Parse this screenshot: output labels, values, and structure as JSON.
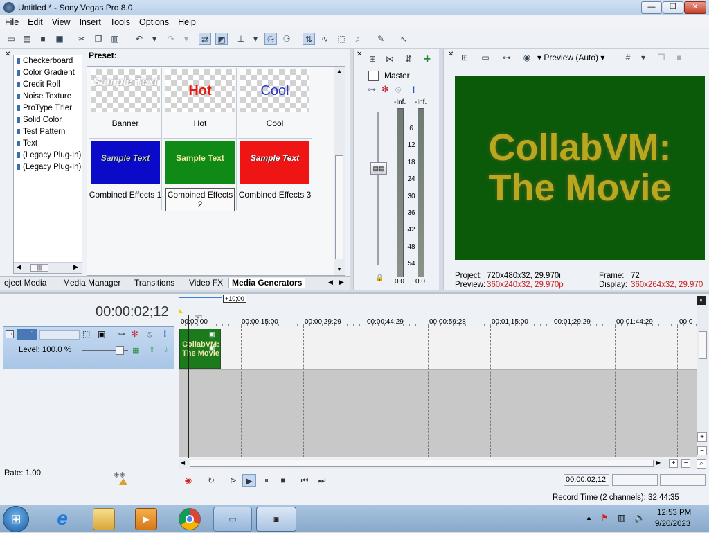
{
  "window": {
    "title": "Untitled * - Sony Vegas Pro 8.0",
    "min": "—",
    "restore": "❐",
    "close": "✕"
  },
  "menu": [
    "File",
    "Edit",
    "View",
    "Insert",
    "Tools",
    "Options",
    "Help"
  ],
  "generators": {
    "items": [
      "Checkerboard",
      "Color Gradient",
      "Credit Roll",
      "Noise Texture",
      "ProType Titler",
      "Solid Color",
      "Test Pattern",
      "Text",
      "(Legacy Plug-In) T",
      "(Legacy Plug-In) V"
    ],
    "preset_label": "Preset:",
    "presets": [
      {
        "name": "Banner",
        "thumb_text": "Sample Text"
      },
      {
        "name": "Hot",
        "thumb_text": "Hot"
      },
      {
        "name": "Cool",
        "thumb_text": "Cool"
      },
      {
        "name": "Combined Effects 1",
        "thumb_text": "Sample Text"
      },
      {
        "name": "Combined Effects 2",
        "thumb_text": "Sample Text"
      },
      {
        "name": "Combined Effects 3",
        "thumb_text": "Sample Text"
      }
    ],
    "tabs": [
      "oject Media",
      "Media Manager",
      "Transitions",
      "Video FX",
      "Media Generators"
    ]
  },
  "mixer": {
    "master_label": "Master",
    "inf_left": "-Inf.",
    "inf_right": "-Inf.",
    "scale": [
      "6",
      "12",
      "18",
      "24",
      "30",
      "36",
      "42",
      "48",
      "54"
    ],
    "val_left": "0.0",
    "val_right": "0.0"
  },
  "preview": {
    "mode": "Preview (Auto)",
    "line1": "CollabVM:",
    "line2": "The Movie",
    "project_label": "Project:",
    "project_value": "720x480x32, 29.970i",
    "frame_label": "Frame:",
    "frame_value": "72",
    "preview_label": "Preview:",
    "preview_value": "360x240x32, 29.970p",
    "display_label": "Display:",
    "display_value": "360x264x32, 29.970",
    "accent": "#cc1f1f",
    "bg": "#0a5a0a",
    "text_color": "#b8a81e"
  },
  "timeline": {
    "timecode": "00:00:02;12",
    "offset_badge": "+10;00",
    "ruler": [
      "00:00:00",
      "00:00:15:00",
      "00:00:29:29",
      "00:00:44:29",
      "00:00:59:28",
      "00:01:15:00",
      "00:01:29:29",
      "00:01:44:29",
      "00:0"
    ],
    "track_number": "1",
    "level": "Level: 100.0 %",
    "clip_text": "CollabVM: The Movie",
    "rate": "Rate: 1.00",
    "position_box": "00:00:02;12"
  },
  "status": {
    "record_time": "Record Time (2 channels): 32:44:35"
  },
  "taskbar": {
    "time": "12:53 PM",
    "date": "9/20/2023"
  }
}
